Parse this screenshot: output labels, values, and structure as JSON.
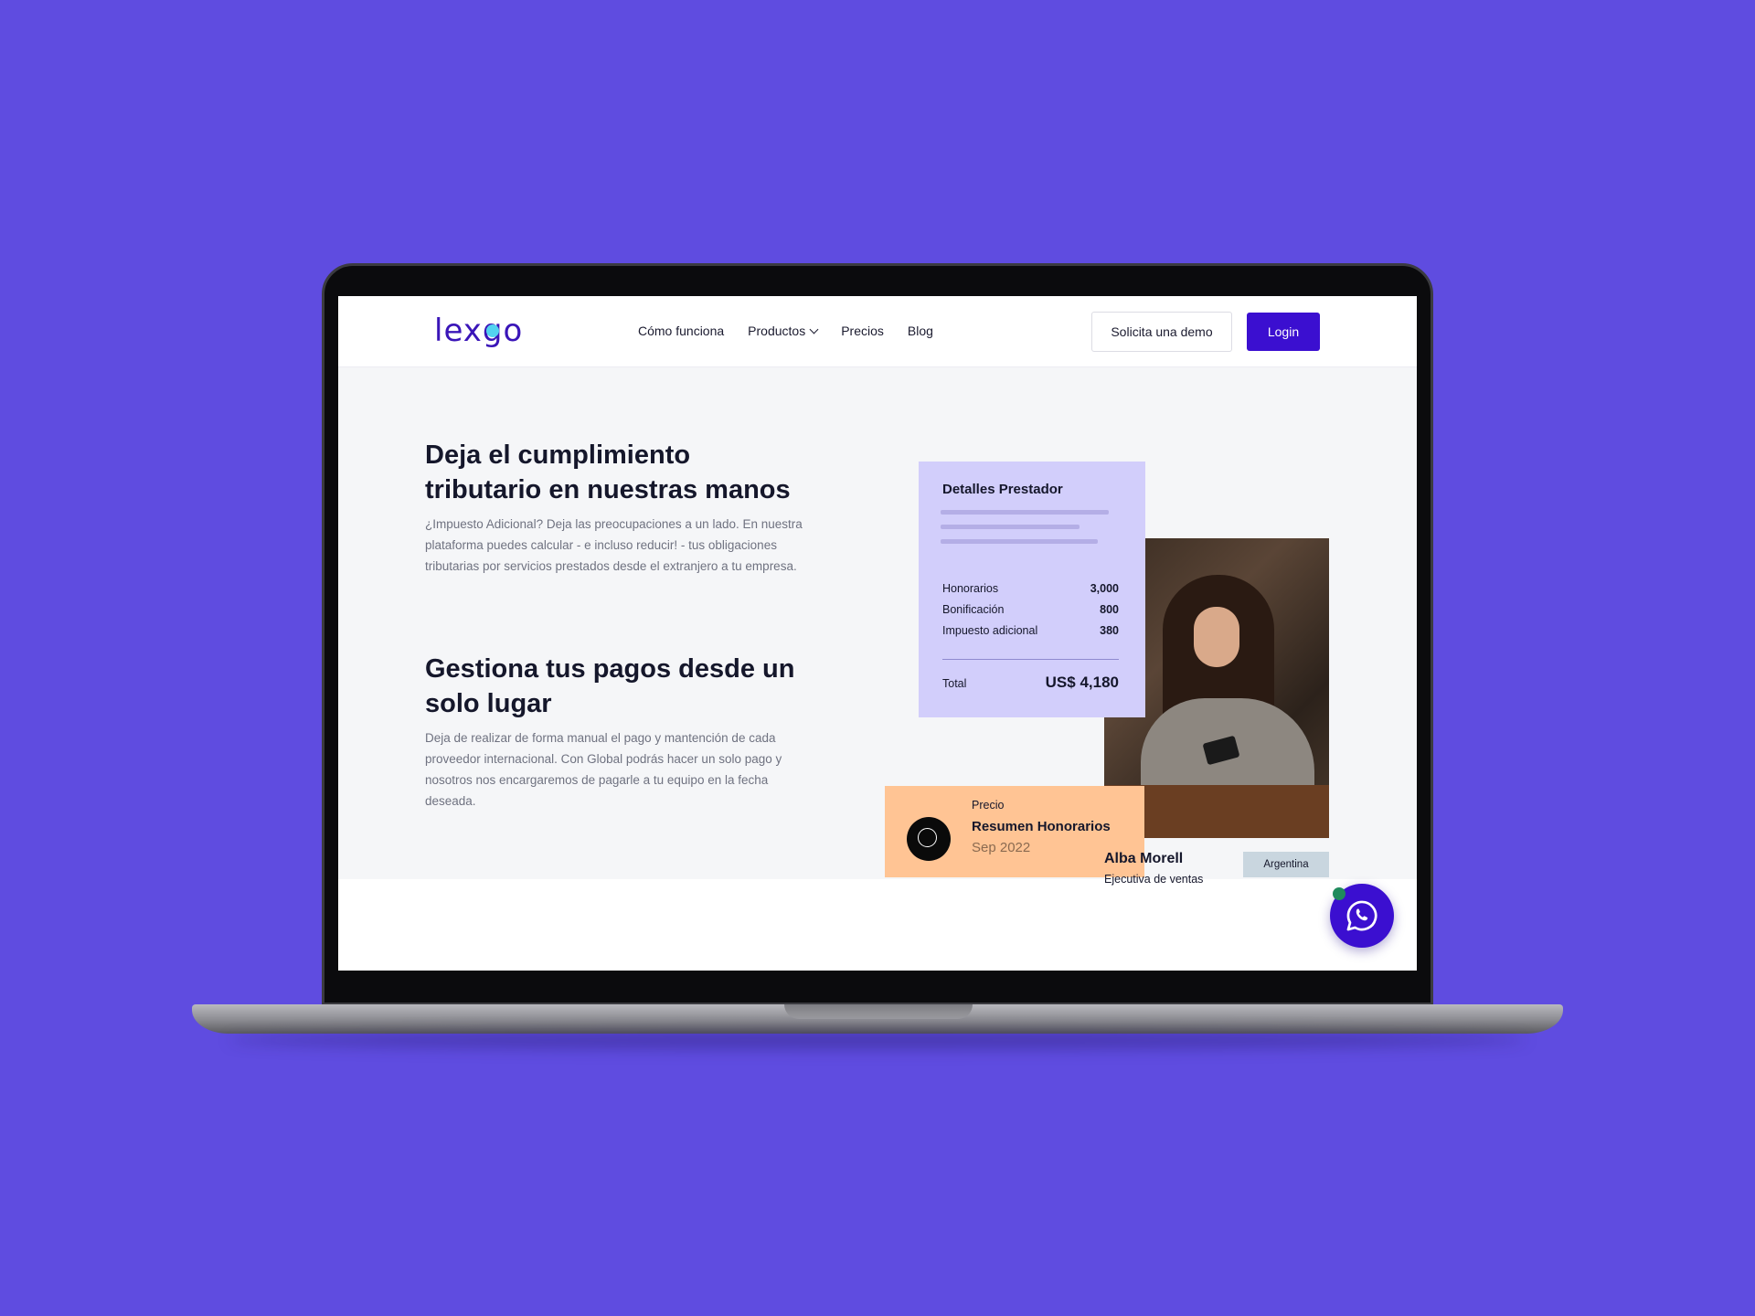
{
  "nav": {
    "logo": "lexgo",
    "links": [
      {
        "label": "Cómo funciona"
      },
      {
        "label": "Productos"
      },
      {
        "label": "Precios"
      },
      {
        "label": "Blog"
      }
    ],
    "demo_label": "Solicita una demo",
    "login_label": "Login"
  },
  "hero": {
    "section1": {
      "heading_line1": "Deja el cumplimiento",
      "heading_line2": "tributario en nuestras manos",
      "paragraph": "¿Impuesto Adicional? Deja las preocupaciones a un lado. En nuestra plataforma puedes calcular - e incluso reducir! - tus obligaciones tributarias por servicios prestados desde el extranjero a tu empresa."
    },
    "section2": {
      "heading": "Gestiona tus pagos desde un solo lugar",
      "paragraph": "Deja de realizar de forma manual el pago y mantención de cada proveedor internacional. Con Global podrás hacer un solo pago y nosotros nos encargaremos de pagarle a tu equipo en la fecha deseada."
    }
  },
  "details_card": {
    "title": "Detalles Prestador",
    "rows": [
      {
        "label": "Honorarios",
        "value": "3,000"
      },
      {
        "label": "Bonificación",
        "value": "800"
      },
      {
        "label": "Impuesto adicional",
        "value": "380"
      }
    ],
    "total_label": "Total",
    "total_value": "US$ 4,180"
  },
  "price_card": {
    "label": "Precio",
    "title": "Resumen Honorarios",
    "date": "Sep 2022"
  },
  "person": {
    "name": "Alba Morell",
    "role": "Ejecutiva de ventas",
    "country": "Argentina"
  },
  "colors": {
    "background": "#5f4ce0",
    "brand": "#3b0fd0",
    "details_card": "#d2cefb",
    "price_card": "#ffc494",
    "badge": "#c9d6df"
  },
  "icons": {
    "fab": "whatsapp-icon",
    "price": "circle-icon",
    "dropdown": "chevron-down-icon"
  }
}
